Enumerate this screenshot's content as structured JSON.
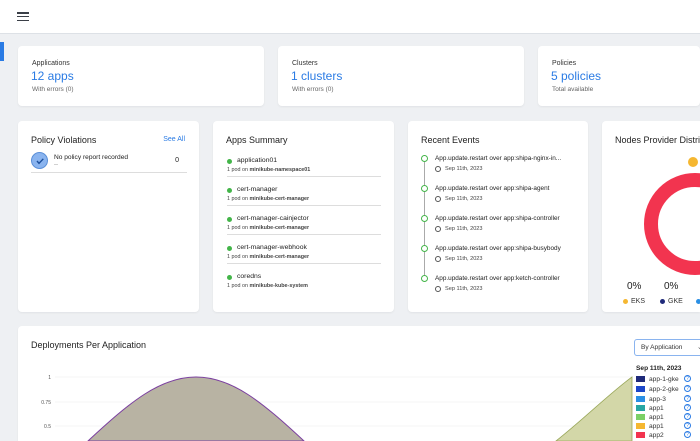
{
  "stats": [
    {
      "label": "Applications",
      "value": "12 apps",
      "sub": "With errors (0)"
    },
    {
      "label": "Clusters",
      "value": "1 clusters",
      "sub": "With errors (0)"
    },
    {
      "label": "Policies",
      "value": "5 policies",
      "sub": "Total available"
    }
  ],
  "policy": {
    "title": "Policy Violations",
    "see_all": "See All",
    "text": "No policy report recorded",
    "dash": "--",
    "count": "0"
  },
  "apps_summary": {
    "title": "Apps Summary",
    "items": [
      {
        "name": "application01",
        "pods": "1 pod on",
        "ns": "minikube-namespace01"
      },
      {
        "name": "cert-manager",
        "pods": "1 pod on",
        "ns": "minikube-cert-manager"
      },
      {
        "name": "cert-manager-cainjector",
        "pods": "1 pod on",
        "ns": "minikube-cert-manager"
      },
      {
        "name": "cert-manager-webhook",
        "pods": "1 pod on",
        "ns": "minikube-cert-manager"
      },
      {
        "name": "coredns",
        "pods": "1 pod on",
        "ns": "minikube-kube-system"
      }
    ]
  },
  "events": {
    "title": "Recent Events",
    "items": [
      {
        "title": "App.update.restart over app:shipa-nginx-in...",
        "date": "Sep 11th, 2023"
      },
      {
        "title": "App.update.restart over app:shipa-agent",
        "date": "Sep 11th, 2023"
      },
      {
        "title": "App.update.restart over app:shipa-controller",
        "date": "Sep 11th, 2023"
      },
      {
        "title": "App.update.restart over app:shipa-busybody",
        "date": "Sep 11th, 2023"
      },
      {
        "title": "App.update.restart over app:ketch-controller",
        "date": "Sep 11th, 2023"
      }
    ]
  },
  "nodes": {
    "title": "Nodes Provider Distrib",
    "pcts": [
      "0%",
      "0%"
    ],
    "legend": [
      {
        "label": "EKS",
        "color": "#f5b731"
      },
      {
        "label": "GKE",
        "color": "#1f2a7a"
      }
    ],
    "ring_color": "#f2344f"
  },
  "deployments": {
    "title": "Deployments Per Application",
    "dropdown": "By Application",
    "date": "Sep 11th, 2023",
    "legend": [
      {
        "label": "app-1-gke",
        "color": "#1f2a7a"
      },
      {
        "label": "app-2-gke",
        "color": "#1c47c9"
      },
      {
        "label": "app-3",
        "color": "#2a8fe4"
      },
      {
        "label": "app1",
        "color": "#27a6a3"
      },
      {
        "label": "app1",
        "color": "#7bd065"
      },
      {
        "label": "app1",
        "color": "#f5b731"
      },
      {
        "label": "app2",
        "color": "#f2344f"
      }
    ],
    "yticks": [
      "1",
      "0.75",
      "0.5"
    ]
  },
  "colors": {
    "accent": "#2a7be4",
    "success": "#43b549"
  }
}
